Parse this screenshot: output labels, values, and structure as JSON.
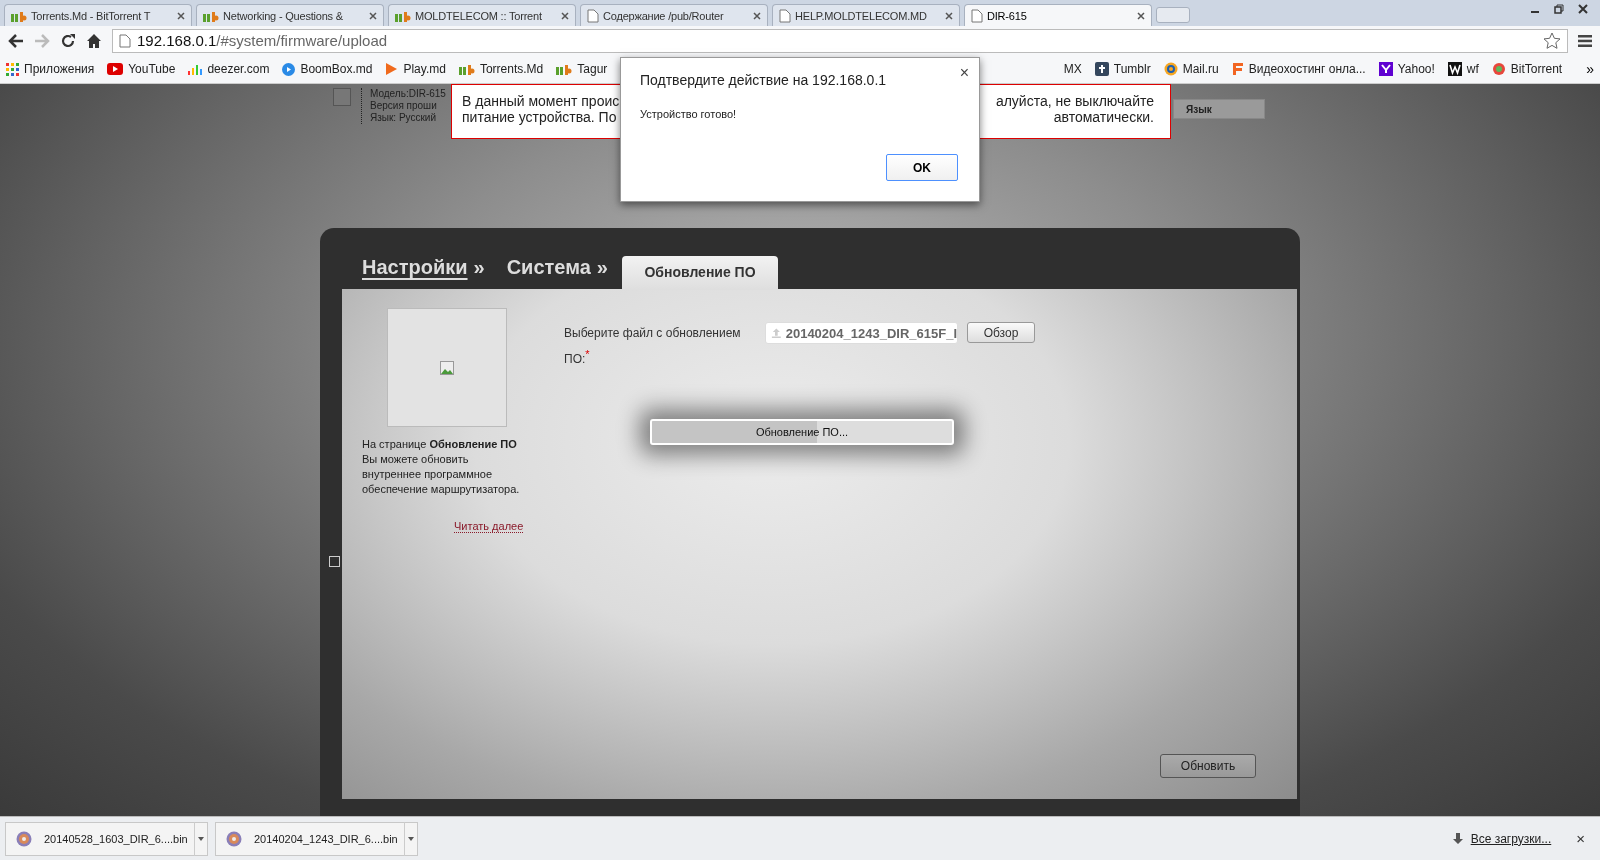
{
  "tabs": [
    {
      "title": "Torrents.Md - BitTorrent T",
      "kind": "md",
      "selected": false
    },
    {
      "title": "Networking - Questions &",
      "kind": "md",
      "selected": false
    },
    {
      "title": "MOLDTELECOM :: Torrent",
      "kind": "md",
      "selected": false
    },
    {
      "title": "Содержание /pub/Router",
      "kind": "page",
      "selected": false
    },
    {
      "title": "HELP.MOLDTELECOM.MD",
      "kind": "page",
      "selected": false
    },
    {
      "title": "DIR-615",
      "kind": "page",
      "selected": true
    }
  ],
  "address": {
    "host": "192.168.0.1",
    "path": "/#system/firmware/upload"
  },
  "bookmarks_left": [
    {
      "label": "Приложения",
      "kind": "apps"
    },
    {
      "label": "YouTube",
      "kind": "youtube"
    },
    {
      "label": "deezer.com",
      "kind": "deezer"
    },
    {
      "label": "BoomBox.md",
      "kind": "boombox"
    },
    {
      "label": "Play.md",
      "kind": "play"
    },
    {
      "label": "Torrents.Md",
      "kind": "md"
    },
    {
      "label": "Tagur",
      "kind": "md"
    }
  ],
  "bookmarks_right": [
    {
      "label": "MX",
      "kind": "none"
    },
    {
      "label": "Tumblr",
      "kind": "tumblr"
    },
    {
      "label": "Mail.ru",
      "kind": "mail"
    },
    {
      "label": "Видеохостинг онла...",
      "kind": "f"
    },
    {
      "label": "Yahoo!",
      "kind": "yahoo"
    },
    {
      "label": "wf",
      "kind": "w"
    },
    {
      "label": "BitTorrent",
      "kind": "bittorrent"
    }
  ],
  "bookmarks_more": "»",
  "device_info": [
    "Модель:DIR-615",
    "Версия проши",
    "Язык: Русский"
  ],
  "alert": {
    "lines": [
      [
        "В данный момент проис",
        "алуйста, не выключайте"
      ],
      [
        "питание устройства. По",
        "автоматически."
      ]
    ]
  },
  "language_button": "Язык",
  "dialog": {
    "title": "Подтвердите действие на 192.168.0.1",
    "close": "×",
    "message": "Устройство готово!",
    "ok": "OK"
  },
  "breadcrumbs": [
    {
      "label": "Настройки",
      "separator": "»"
    },
    {
      "label": "Система",
      "separator": "»"
    }
  ],
  "active_tab": "Обновление ПО",
  "description": "На странице **Обновление ПО** Вы можете обновить внутреннее программное обеспечение маршрутизатора.",
  "read_more": "Читать далее",
  "file_label": "Выберите файл с обновлением ПО:",
  "required_mark": "*",
  "file_value": "20140204_1243_DIR_615F_I",
  "browse_button": "Обзор",
  "progress": {
    "label": "Обновление ПО...",
    "level": 0.55
  },
  "update_button": "Обновить",
  "side_checkbox": {
    "checked": false
  },
  "downloads": [
    {
      "name": "20140528_1603_DIR_6....bin"
    },
    {
      "name": "20140204_1243_DIR_6....bin"
    }
  ],
  "all_downloads": "Все загрузки...",
  "downloads_close": "×"
}
